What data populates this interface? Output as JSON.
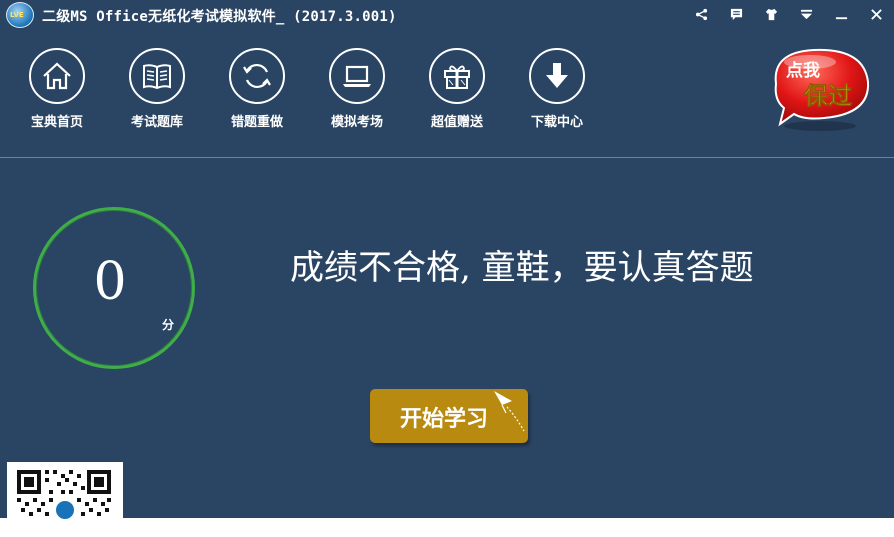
{
  "window": {
    "title": "二级MS Office无纸化考试模拟软件_ (2017.3.001)",
    "logo_text": "LVE"
  },
  "title_controls": [
    {
      "name": "share-icon"
    },
    {
      "name": "message-icon"
    },
    {
      "name": "skin-icon"
    },
    {
      "name": "menu-dropdown-icon"
    },
    {
      "name": "minimize-icon"
    },
    {
      "name": "close-icon"
    }
  ],
  "toolbar": {
    "items": [
      {
        "label": "宝典首页",
        "icon": "home-icon"
      },
      {
        "label": "考试题库",
        "icon": "book-icon"
      },
      {
        "label": "错题重做",
        "icon": "refresh-icon"
      },
      {
        "label": "模拟考场",
        "icon": "laptop-icon"
      },
      {
        "label": "超值赠送",
        "icon": "gift-icon"
      },
      {
        "label": "下载中心",
        "icon": "download-icon"
      }
    ]
  },
  "badge": {
    "line1": "点我",
    "line2": "保过"
  },
  "result": {
    "score": "0",
    "unit": "分",
    "message": "成绩不合格, 童鞋，要认真答题"
  },
  "start_button": {
    "label": "开始学习"
  },
  "colors": {
    "background": "#2a4563",
    "score_ring": "#3fae49",
    "start_button": "#b98a10",
    "badge_red": "#e01515",
    "badge_yellow": "#ffe21a"
  }
}
